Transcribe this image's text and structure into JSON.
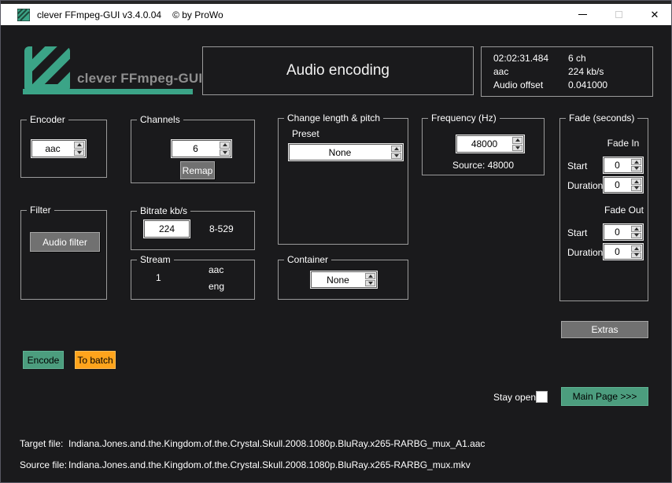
{
  "window": {
    "title": "clever FFmpeg-GUI v3.4.0.04",
    "copyright": "© by ProWo",
    "icons": {
      "close": "✕"
    }
  },
  "header": {
    "logo_text": "clever FFmpeg-GUI",
    "page_title": "Audio encoding",
    "info": {
      "duration": "02:02:31.484",
      "codec": "aac",
      "offset_label": "Audio offset",
      "channels": "6 ch",
      "bitrate": "224 kb/s",
      "offset_value": "0.041000"
    }
  },
  "groups": {
    "encoder": {
      "label": "Encoder",
      "value": "aac"
    },
    "channels": {
      "label": "Channels",
      "value": "6",
      "remap_button": "Remap"
    },
    "filter": {
      "label": "Filter",
      "audio_filter_button": "Audio filter"
    },
    "bitrate": {
      "label": "Bitrate kb/s",
      "value": "224",
      "range": "8-529"
    },
    "stream": {
      "label": "Stream",
      "index": "1",
      "codec": "aac",
      "language": "eng"
    },
    "length_pitch": {
      "label": "Change length & pitch",
      "preset_label": "Preset",
      "preset_value": "None"
    },
    "container": {
      "label": "Container",
      "value": "None"
    },
    "frequency": {
      "label": "Frequency (Hz)",
      "value": "48000",
      "source": "Source: 48000"
    },
    "fade": {
      "label": "Fade (seconds)",
      "fade_in_label": "Fade In",
      "fade_out_label": "Fade Out",
      "start_label": "Start",
      "duration_label": "Duration",
      "fade_in_start": "0",
      "fade_in_duration": "0",
      "fade_out_start": "0",
      "fade_out_duration": "0"
    }
  },
  "actions": {
    "extras": "Extras",
    "encode": "Encode",
    "to_batch": "To batch",
    "stay_open": "Stay open",
    "main_page": "Main Page >>>"
  },
  "files": {
    "target_label": "Target file:",
    "target_value": "Indiana.Jones.and.the.Kingdom.of.the.Crystal.Skull.2008.1080p.BluRay.x265-RARBG_mux_A1.aac",
    "source_label": "Source file:",
    "source_value": "Indiana.Jones.and.the.Kingdom.of.the.Crystal.Skull.2008.1080p.BluRay.x265-RARBG_mux.mkv"
  },
  "colors": {
    "accent_green": "#4C9D7E",
    "accent_orange": "#FFA41C",
    "logo_green": "#3BA487",
    "window_bg": "#1a1a1c"
  }
}
